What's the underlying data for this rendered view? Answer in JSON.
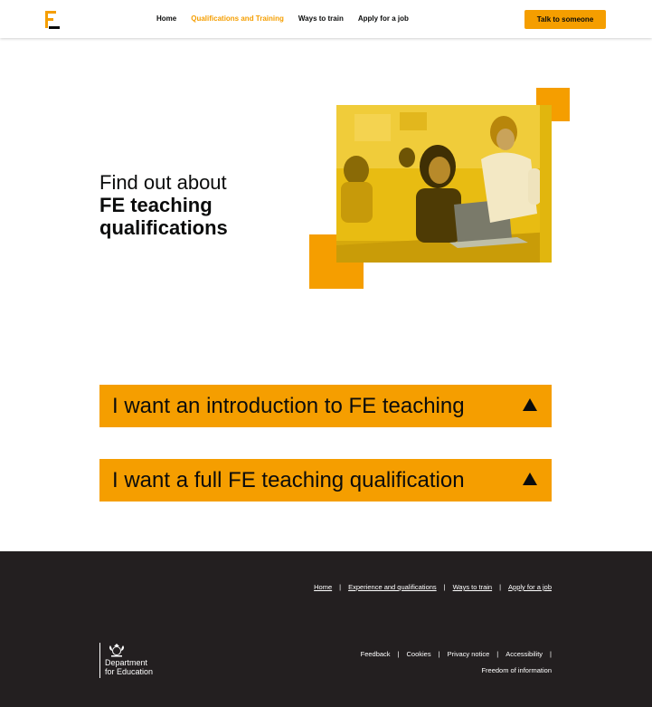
{
  "header": {
    "logo_letter": "E",
    "nav": [
      {
        "label": "Home",
        "active": false
      },
      {
        "label": "Qualifications and Training",
        "active": true
      },
      {
        "label": "Ways to train",
        "active": false
      },
      {
        "label": "Apply for a job",
        "active": false
      }
    ],
    "cta_label": "Talk to someone"
  },
  "hero": {
    "line1": "Find out about",
    "line2": "FE teaching",
    "line3": "qualifications"
  },
  "accordions": [
    {
      "label": "I want an introduction to FE teaching"
    },
    {
      "label": "I want a full FE teaching qualification"
    }
  ],
  "footer": {
    "primary_links": [
      "Home",
      "Experience and qualifications",
      "Ways to train",
      "Apply for a job"
    ],
    "secondary_links": [
      "Feedback",
      "Cookies",
      "Privacy notice",
      "Accessibility"
    ],
    "foi_link": "Freedom of information",
    "dept_line1": "Department",
    "dept_line2": "for Education"
  },
  "colors": {
    "accent": "#f59e00",
    "footer_bg": "#231f20",
    "text": "#0b0c0c"
  }
}
